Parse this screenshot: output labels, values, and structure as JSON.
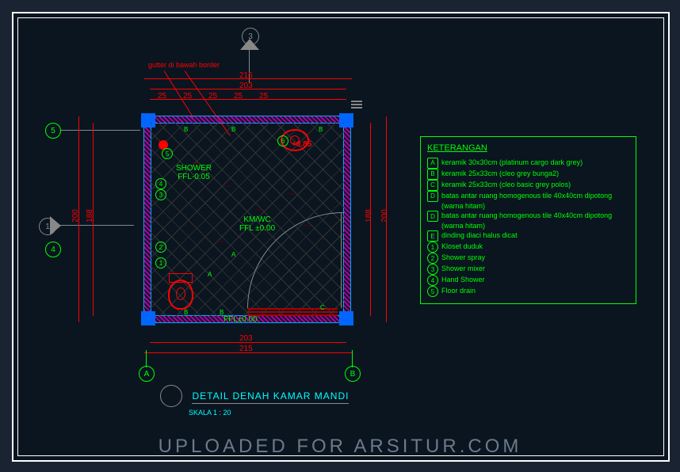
{
  "watermark": "UPLOADED FOR ARSITUR.COM",
  "title": {
    "main": "DETAIL DENAH KAMAR MANDI",
    "scale": "SKALA 1 : 20"
  },
  "notes": {
    "gutter": "gutter di bawah border"
  },
  "rooms": {
    "shower": {
      "name": "SHOWER",
      "level": "FFL-0.05"
    },
    "kmwc": {
      "name": "KM/WC",
      "level": "FFL ±0.00"
    },
    "ffl_bottom": "FFL±0.00",
    "sink_level": "+0.85"
  },
  "dimensions": {
    "top_outer": "215",
    "top_inner": "203",
    "top_seg": [
      "25",
      "25",
      "25",
      "25",
      "25"
    ],
    "left_outer": "200",
    "left_inner": "188",
    "right_outer": "200",
    "right_inner": "188",
    "bottom_outer": "215",
    "bottom_inner": "203"
  },
  "section_markers": {
    "top": "3",
    "left": "1",
    "left_grid": "4",
    "left_top_grid": "5"
  },
  "grid_markers": {
    "a": "A",
    "b": "B"
  },
  "callouts": {
    "c1": "1",
    "c2": "2",
    "c3": "3",
    "c4": "4",
    "c5": "5",
    "c6": "6"
  },
  "tile_labels": {
    "a": "A",
    "b": "B",
    "c": "C"
  },
  "legend": {
    "title": "KETERANGAN",
    "items": [
      {
        "sym": "A",
        "shape": "hex",
        "text": "keramik 30x30cm (platinum cargo dark grey)"
      },
      {
        "sym": "B",
        "shape": "hex",
        "text": "keramik 25x33cm (cleo grey bunga2)"
      },
      {
        "sym": "C",
        "shape": "hex",
        "text": "keramik 25x33cm (cleo basic grey polos)"
      },
      {
        "sym": "D",
        "shape": "hex",
        "text": "batas antar ruang homogenous tile 40x40cm dipotong (warna hitam)"
      },
      {
        "sym": "D",
        "shape": "hex",
        "text": "batas antar ruang homogenous tile 40x40cm dipotong (warna hitam)"
      },
      {
        "sym": "E",
        "shape": "hex",
        "text": "dinding diaci halus dicat"
      },
      {
        "sym": "1",
        "shape": "circle",
        "text": "Kloset duduk"
      },
      {
        "sym": "2",
        "shape": "circle",
        "text": "Shower spray"
      },
      {
        "sym": "3",
        "shape": "circle",
        "text": "Shower mixer"
      },
      {
        "sym": "4",
        "shape": "circle",
        "text": "Hand Shower"
      },
      {
        "sym": "5",
        "shape": "circle",
        "text": "Floor drain"
      }
    ]
  }
}
